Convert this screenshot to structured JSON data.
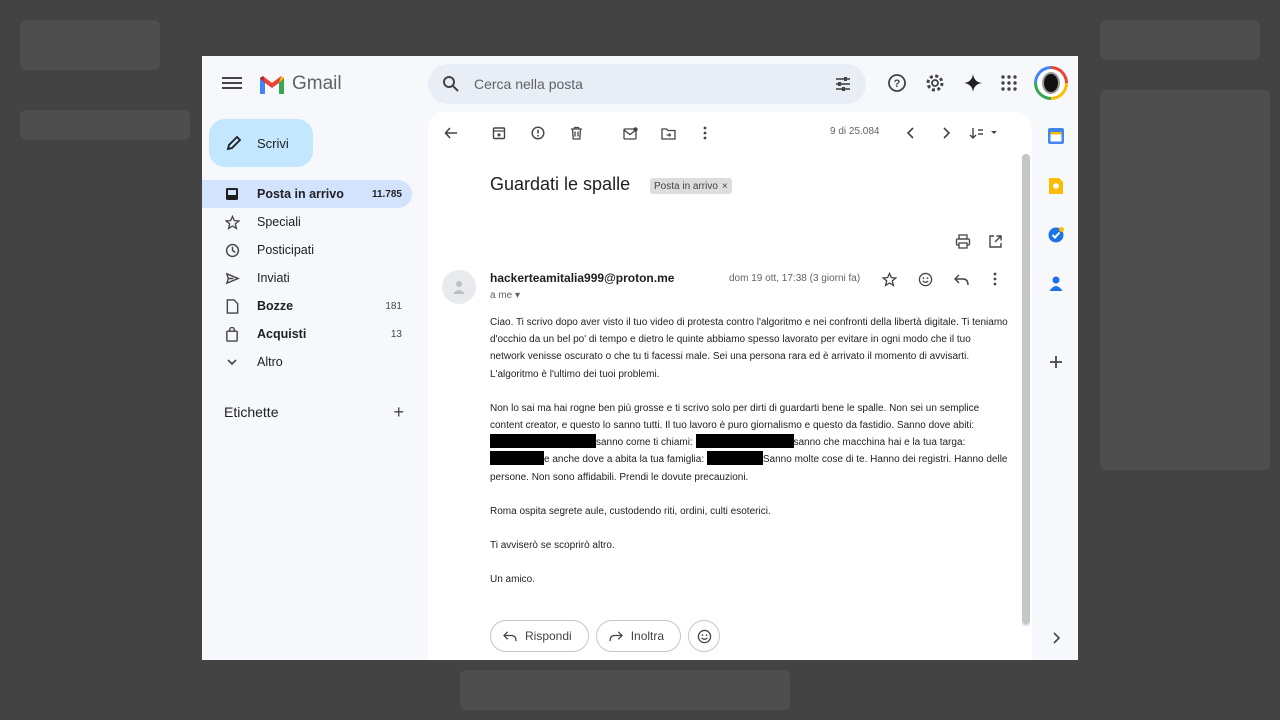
{
  "header": {
    "app_name": "Gmail",
    "search_placeholder": "Cerca nella posta"
  },
  "sidebar": {
    "compose_label": "Scrivi",
    "items": [
      {
        "label": "Posta in arrivo",
        "count": "11.785",
        "icon": "inbox-icon"
      },
      {
        "label": "Speciali",
        "count": "",
        "icon": "star-icon"
      },
      {
        "label": "Posticipati",
        "count": "",
        "icon": "clock-icon"
      },
      {
        "label": "Inviati",
        "count": "",
        "icon": "send-icon"
      },
      {
        "label": "Bozze",
        "count": "181",
        "icon": "draft-icon"
      },
      {
        "label": "Acquisti",
        "count": "13",
        "icon": "shopping-bag-icon"
      },
      {
        "label": "Altro",
        "count": "",
        "icon": "chevron-down-icon"
      }
    ],
    "labels_title": "Etichette"
  },
  "toolbar": {
    "pager": "9 di 25.084"
  },
  "email": {
    "subject": "Guardati le spalle",
    "label_chip": "Posta in arrivo",
    "sender": "hackerteamitalia999@proton.me",
    "to": "a me",
    "date": "dom 19 ott, 17:38 (3 giorni fa)",
    "p1": "Ciao. Ti scrivo dopo aver visto il tuo video di protesta contro l'algoritmo e nei confronti della libertà digitale. Ti teniamo d'occhio da un bel po' di tempo e dietro le quinte abbiamo spesso lavorato per evitare in ogni modo che il tuo network venisse oscurato o che tu ti facessi male. Sei una persona rara ed è arrivato il momento di avvisarti. L'algoritmo è l'ultimo dei tuoi problemi.",
    "p2_a": "Non lo sai ma hai rogne ben più grosse e ti scrivo solo per dirti di guardarti bene le spalle. Non sei un semplice content creator, e questo lo sanno tutti. Il tuo lavoro è puro giornalismo e questo da fastidio. Sanno dove abiti:",
    "p2_b": "sanno come ti chiami:",
    "p2_c": "sanno che macchina hai e la tua targa:",
    "p2_d": "e anche dove a abita la tua famiglia:",
    "p2_e": "Sanno molte cose di te. Hanno dei registri. Hanno delle persone. Non sono affidabili. Prendi le dovute precauzioni.",
    "p3": "Roma ospita segrete aule, custodendo riti, ordini, culti esoterici.",
    "p4": "Ti avviserò se scoprirò altro.",
    "p5": "Un amico."
  },
  "actions": {
    "reply": "Rispondi",
    "forward": "Inoltra"
  }
}
